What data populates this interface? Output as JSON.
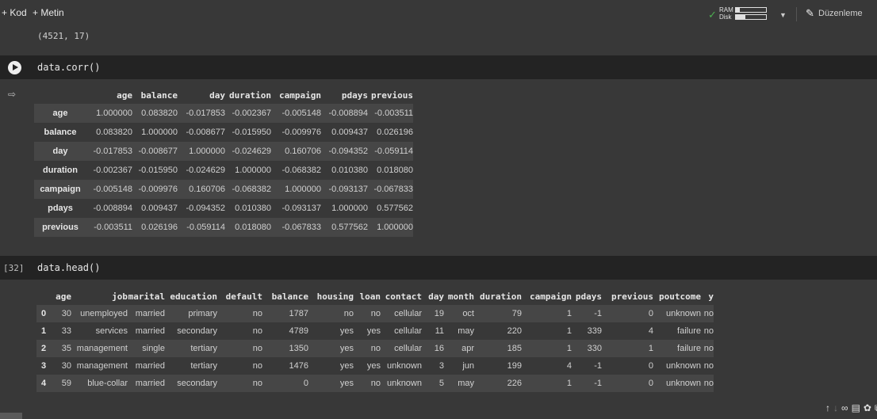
{
  "toolbar": {
    "add_code": "+ Kod",
    "add_text": "+ Metin",
    "ram_label": "RAM",
    "disk_label": "Disk",
    "ram_usage": 0.12,
    "disk_usage": 0.32,
    "edit_label": "Düzenleme"
  },
  "prev_output": "(4521, 17)",
  "cell1": {
    "code": "data.corr()"
  },
  "corr": {
    "columns": [
      "age",
      "balance",
      "day",
      "duration",
      "campaign",
      "pdays",
      "previous"
    ],
    "rows": [
      {
        "label": "age",
        "values": [
          "1.000000",
          "0.083820",
          "-0.017853",
          "-0.002367",
          "-0.005148",
          "-0.008894",
          "-0.003511"
        ]
      },
      {
        "label": "balance",
        "values": [
          "0.083820",
          "1.000000",
          "-0.008677",
          "-0.015950",
          "-0.009976",
          "0.009437",
          "0.026196"
        ]
      },
      {
        "label": "day",
        "values": [
          "-0.017853",
          "-0.008677",
          "1.000000",
          "-0.024629",
          "0.160706",
          "-0.094352",
          "-0.059114"
        ]
      },
      {
        "label": "duration",
        "values": [
          "-0.002367",
          "-0.015950",
          "-0.024629",
          "1.000000",
          "-0.068382",
          "0.010380",
          "0.018080"
        ]
      },
      {
        "label": "campaign",
        "values": [
          "-0.005148",
          "-0.009976",
          "0.160706",
          "-0.068382",
          "1.000000",
          "-0.093137",
          "-0.067833"
        ]
      },
      {
        "label": "pdays",
        "values": [
          "-0.008894",
          "0.009437",
          "-0.094352",
          "0.010380",
          "-0.093137",
          "1.000000",
          "0.577562"
        ]
      },
      {
        "label": "previous",
        "values": [
          "-0.003511",
          "0.026196",
          "-0.059114",
          "0.018080",
          "-0.067833",
          "0.577562",
          "1.000000"
        ]
      }
    ]
  },
  "cell2": {
    "exec_count": "[32]",
    "code": "data.head()"
  },
  "head": {
    "columns": [
      "age",
      "job",
      "marital",
      "education",
      "default",
      "balance",
      "housing",
      "loan",
      "contact",
      "day",
      "month",
      "duration",
      "campaign",
      "pdays",
      "previous",
      "poutcome",
      "y"
    ],
    "rows": [
      {
        "label": "0",
        "values": [
          "30",
          "unemployed",
          "married",
          "primary",
          "no",
          "1787",
          "no",
          "no",
          "cellular",
          "19",
          "oct",
          "79",
          "1",
          "-1",
          "0",
          "unknown",
          "no"
        ]
      },
      {
        "label": "1",
        "values": [
          "33",
          "services",
          "married",
          "secondary",
          "no",
          "4789",
          "yes",
          "yes",
          "cellular",
          "11",
          "may",
          "220",
          "1",
          "339",
          "4",
          "failure",
          "no"
        ]
      },
      {
        "label": "2",
        "values": [
          "35",
          "management",
          "single",
          "tertiary",
          "no",
          "1350",
          "yes",
          "no",
          "cellular",
          "16",
          "apr",
          "185",
          "1",
          "330",
          "1",
          "failure",
          "no"
        ]
      },
      {
        "label": "3",
        "values": [
          "30",
          "management",
          "married",
          "tertiary",
          "no",
          "1476",
          "yes",
          "yes",
          "unknown",
          "3",
          "jun",
          "199",
          "4",
          "-1",
          "0",
          "unknown",
          "no"
        ]
      },
      {
        "label": "4",
        "values": [
          "59",
          "blue-collar",
          "married",
          "secondary",
          "no",
          "0",
          "yes",
          "no",
          "unknown",
          "5",
          "may",
          "226",
          "1",
          "-1",
          "0",
          "unknown",
          "no"
        ]
      }
    ]
  },
  "icons": [
    "arrow-up-icon",
    "arrow-down-icon",
    "link-icon",
    "comment-icon",
    "gear-icon",
    "copy-icon",
    "trash-icon"
  ]
}
